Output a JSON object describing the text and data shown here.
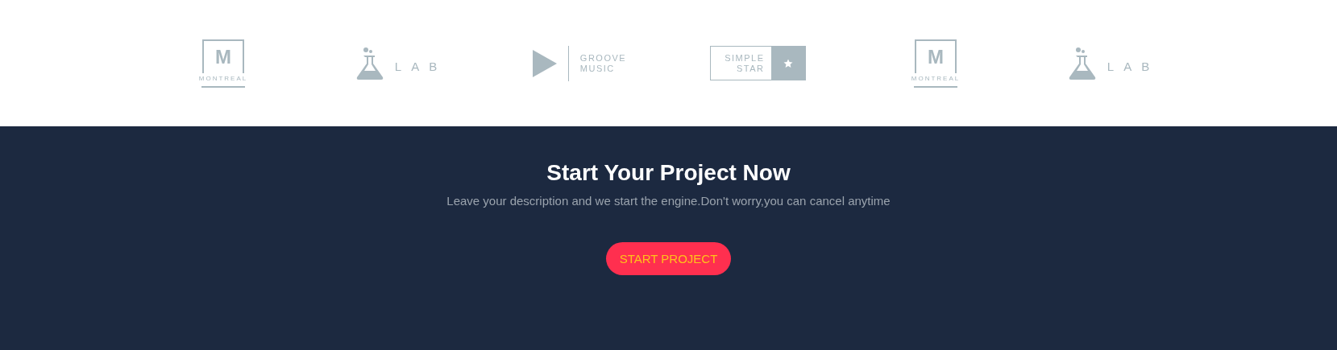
{
  "logos": [
    {
      "kind": "montreal",
      "lines": [
        "M",
        "MONTREAL"
      ]
    },
    {
      "kind": "lab",
      "lines": [
        "LAB"
      ]
    },
    {
      "kind": "groove",
      "lines": [
        "GROOVE",
        "MUSIC"
      ]
    },
    {
      "kind": "simple-star",
      "lines": [
        "SIMPLE",
        "STAR"
      ]
    },
    {
      "kind": "montreal",
      "lines": [
        "M",
        "MONTREAL"
      ]
    },
    {
      "kind": "lab",
      "lines": [
        "LAB"
      ]
    }
  ],
  "cta": {
    "title": "Start Your Project Now",
    "subtitle": "Leave your description and we start the engine.Don't worry,you can cancel anytime",
    "button": "START PROJECT"
  }
}
